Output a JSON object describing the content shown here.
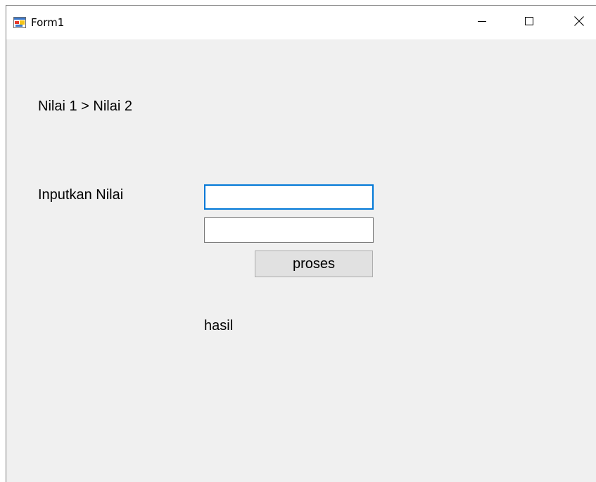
{
  "window": {
    "title": "Form1",
    "icon": "winforms-app-icon",
    "controls": {
      "minimize_icon": "minimize-icon",
      "maximize_icon": "maximize-icon",
      "close_icon": "close-icon"
    }
  },
  "form": {
    "heading_label": "Nilai 1 > Nilai 2",
    "input_label": "Inputkan Nilai",
    "textbox1": {
      "value": ""
    },
    "textbox2": {
      "value": ""
    },
    "process_button": "proses",
    "result_label": "hasil"
  },
  "colors": {
    "client_background": "#f0f0f0",
    "titlebar_background": "#ffffff",
    "focus_border": "#0078d7",
    "button_background": "#e1e1e1"
  }
}
